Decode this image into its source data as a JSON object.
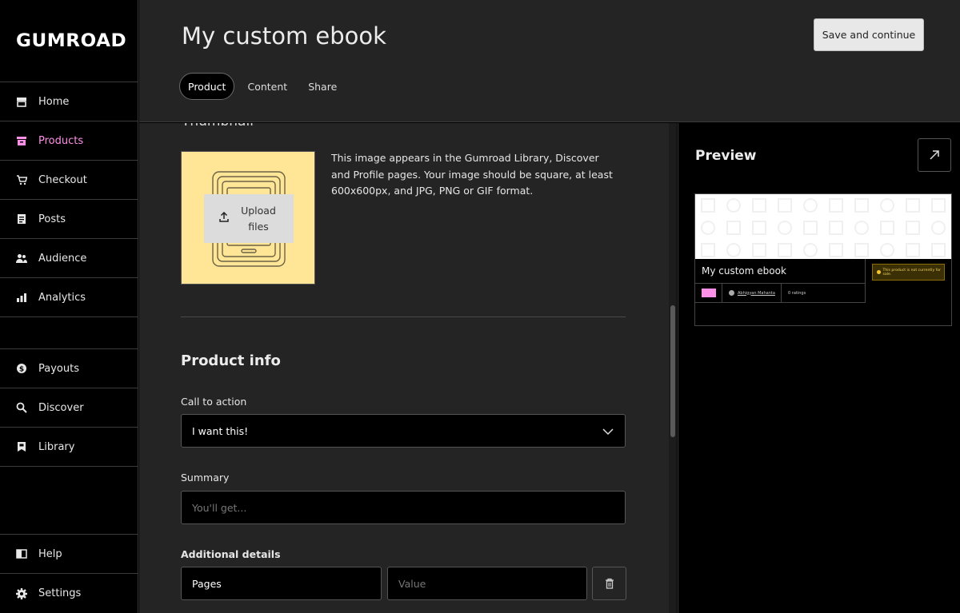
{
  "app": {
    "logo": "GUMROAD"
  },
  "sidebar": {
    "items": [
      {
        "label": "Home",
        "icon": "store-icon"
      },
      {
        "label": "Products",
        "icon": "archive-icon"
      },
      {
        "label": "Checkout",
        "icon": "cart-icon"
      },
      {
        "label": "Posts",
        "icon": "document-icon"
      },
      {
        "label": "Audience",
        "icon": "people-icon"
      },
      {
        "label": "Analytics",
        "icon": "bar-chart-icon"
      },
      {
        "label": "Payouts",
        "icon": "dollar-circle-icon"
      },
      {
        "label": "Discover",
        "icon": "search-icon"
      },
      {
        "label": "Library",
        "icon": "bookmark-icon"
      }
    ],
    "bottom": [
      {
        "label": "Help",
        "icon": "book-icon"
      },
      {
        "label": "Settings",
        "icon": "gear-icon"
      }
    ],
    "active_item": "Products",
    "active_color": "#ff90e8"
  },
  "header": {
    "title": "My custom ebook",
    "save_label": "Save and continue",
    "tabs": [
      {
        "label": "Product"
      },
      {
        "label": "Content"
      },
      {
        "label": "Share"
      }
    ],
    "active_tab": "Product"
  },
  "main": {
    "cut_heading": "Thumbnail",
    "thumbnail": {
      "upload_label": "Upload files",
      "background_color": "#ffe596",
      "description": "This image appears in the Gumroad Library, Discover and Profile pages. Your image should be square, at least 600x600px, and JPG, PNG or GIF format."
    },
    "product_info": {
      "title": "Product info",
      "cta_label": "Call to action",
      "cta_value": "I want this!",
      "summary_label": "Summary",
      "summary_placeholder": "You'll get...",
      "additional_label": "Additional details",
      "detail_name": "Pages",
      "detail_value_placeholder": "Value"
    }
  },
  "preview": {
    "title": "Preview",
    "card": {
      "name": "My custom ebook",
      "author": "Abhigyan Mahanta",
      "ratings": "0 ratings",
      "notice": "This product is not currently for sale."
    }
  }
}
